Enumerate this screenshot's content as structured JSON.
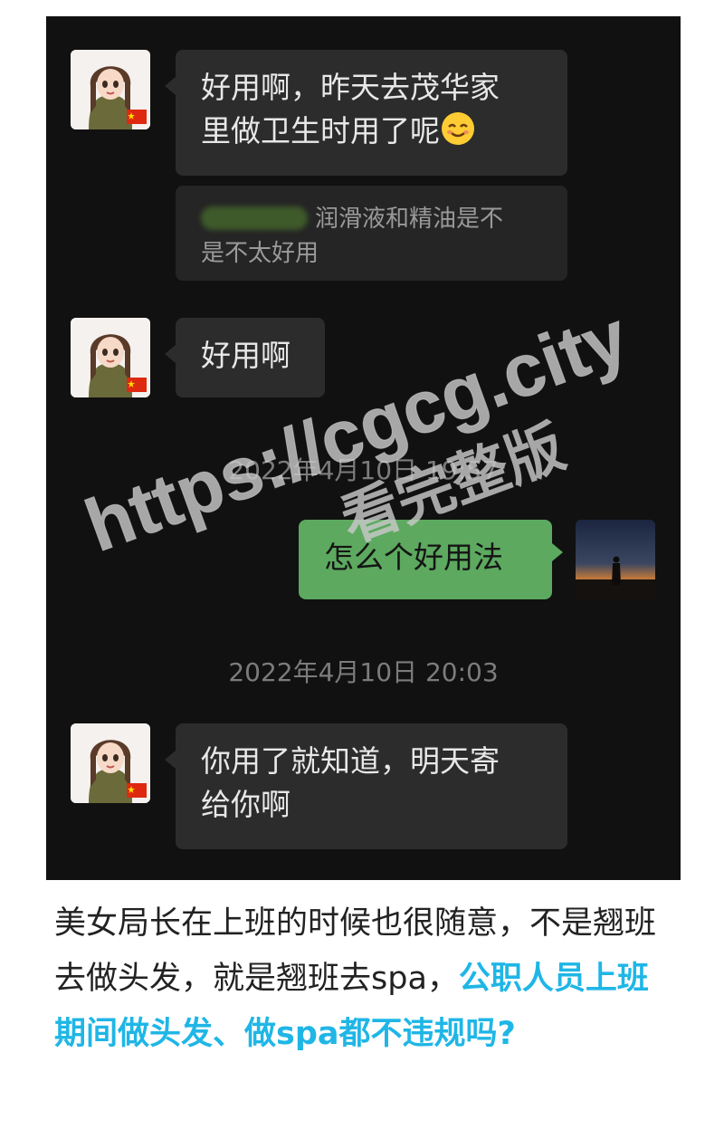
{
  "chat": {
    "messages": [
      {
        "sender": "contact",
        "text_line1": "好用啊，昨天去茂华家",
        "text_line2": "里做卫生时用了呢",
        "emoji": "smiling-face-emoji"
      },
      {
        "sender": "contact",
        "type": "quote",
        "quote_text_line1": "润滑液和精油是不",
        "quote_text_line2": "是不太好用"
      },
      {
        "sender": "contact",
        "text": "好用啊"
      },
      {
        "sender": "self",
        "text": "怎么个好用法"
      },
      {
        "sender": "contact",
        "text_line1": "你用了就知道，明天寄",
        "text_line2": "给你啊"
      }
    ],
    "timestamps": {
      "first": "2022年4月10日 19:57",
      "second": "2022年4月10日 20:03"
    },
    "colors": {
      "background": "#111111",
      "incoming_bubble": "#2c2c2c",
      "outgoing_bubble": "#5ca95f"
    }
  },
  "watermark": {
    "url_text": "https://cgcg.city",
    "cta_text": "看完整版"
  },
  "caption": {
    "plain": "美女局长在上班的时候也很随意，不是翘班去做头发，就是翘班去spa，",
    "highlight": "公职人员上班期间做头发、做spa都不违规吗?",
    "highlight_color": "#1fb6e6"
  }
}
